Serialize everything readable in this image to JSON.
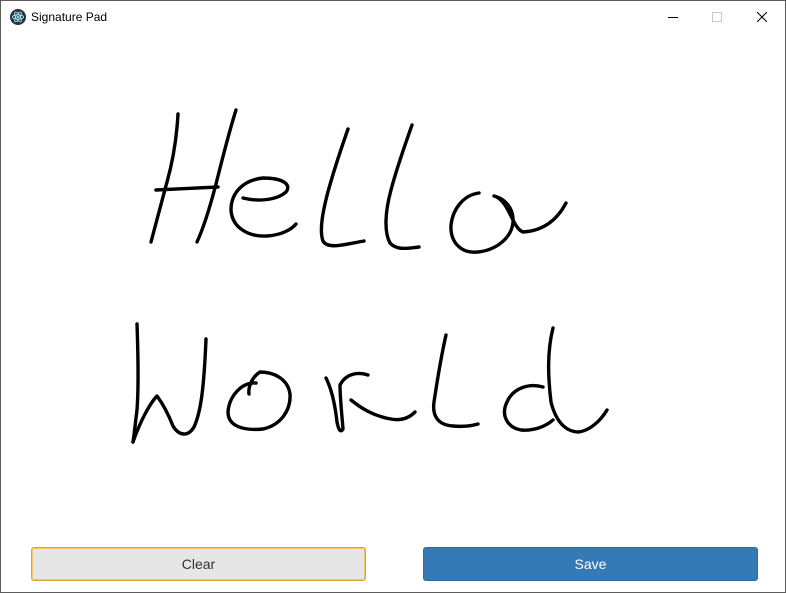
{
  "window": {
    "title": "Signature Pad"
  },
  "canvas": {
    "stroke_color": "#000000"
  },
  "actions": {
    "clear_label": "Clear",
    "save_label": "Save"
  },
  "colors": {
    "save_bg": "#337ab7",
    "clear_bg": "#e6e6e6",
    "clear_focus_border": "#e0a32e"
  }
}
